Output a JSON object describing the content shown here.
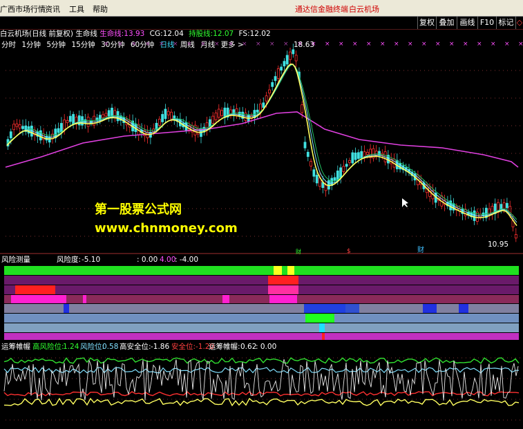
{
  "menubar": {
    "items": [
      "广西市场行情",
      "资讯",
      "工具",
      "帮助"
    ],
    "brand": "通达信金融终端",
    "brand_sub": "白云机场"
  },
  "toolbar": {
    "buttons": [
      "复权",
      "叠加",
      "画线",
      "F10",
      "标记",
      "◇"
    ]
  },
  "info": {
    "title": "白云机场(日线 前复权) 生命线",
    "line1_label": "生命线:",
    "line1_value": "13.93",
    "cg_label": "CG:",
    "cg_value": "12.04",
    "support_label": "持股线:",
    "support_value": "12.07",
    "fs_label": "FS:",
    "fs_value": "12.02"
  },
  "periods": {
    "items": [
      "分时",
      "1分钟",
      "5分钟",
      "15分钟",
      "30分钟",
      "60分钟",
      "日线",
      "周线",
      "月线",
      "更多 >"
    ],
    "active": "日线"
  },
  "price_chart": {
    "high_label": "18.63",
    "low_label": "10.95",
    "markers": [
      "财",
      "$",
      "财"
    ],
    "watermark_cn": "第一股票公式网",
    "watermark_url": "www.chnmoney.com"
  },
  "risk_panel": {
    "name": "风险测量",
    "risk_label": "风险度:",
    "risk_value": "-5.10",
    "v1": ": 0.00",
    "v2": "4.00",
    "v3": ": -4.00"
  },
  "osc_panel": {
    "name": "运筹帷幄",
    "high_label": "高风险位:",
    "high_value": "1.24",
    "risk_label": "风险位:",
    "risk_value": "0.58",
    "hsafe_label": "高安全位:",
    "hsafe_value": "-1.86",
    "safe_label": "安全位:",
    "safe_value": "-1.20",
    "op_label": "运筹帷幄:",
    "op_value": "0.62",
    "op_value2": ": 0.00"
  },
  "colors": {
    "up": "#ff3030",
    "down": "#40e0e0",
    "life_line": "#ffff60",
    "ma_long": "#e040e0",
    "green": "#10e010"
  }
}
